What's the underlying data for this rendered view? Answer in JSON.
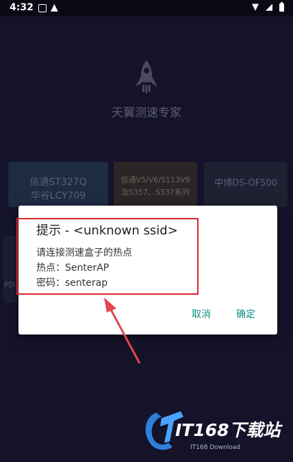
{
  "status_bar": {
    "time": "4:32",
    "icons": [
      "image-notification-icon",
      "warning-icon",
      "wifi-icon",
      "signal-icon",
      "battery-icon"
    ]
  },
  "app": {
    "title": "天翼测速专家",
    "logo_icon": "rocket-icon"
  },
  "devices": [
    {
      "lines": [
        "信通ST327Q",
        "华谷LCY709"
      ]
    },
    {
      "lines": [
        "信通V5/V6/S113V9",
        "及S357、S337系列"
      ]
    },
    {
      "lines": [
        "中博DS-OF500"
      ]
    },
    {
      "lines": [
        "PD"
      ]
    }
  ],
  "dialog": {
    "title": "提示 - <unknown ssid>",
    "message_line1": "请连接测速盒子的热点",
    "hotspot_line": "热点：SenterAP",
    "password_line": "密码：senterap",
    "cancel_label": "取消",
    "ok_label": "确定"
  },
  "annotation": {
    "highlight_color": "#d8242c"
  },
  "watermark": {
    "text": "IT168下载站",
    "subtext": "IT168 Download"
  },
  "colors": {
    "background": "#14132a",
    "dialog_button": "#0b9080",
    "highlight": "#d8242c"
  }
}
